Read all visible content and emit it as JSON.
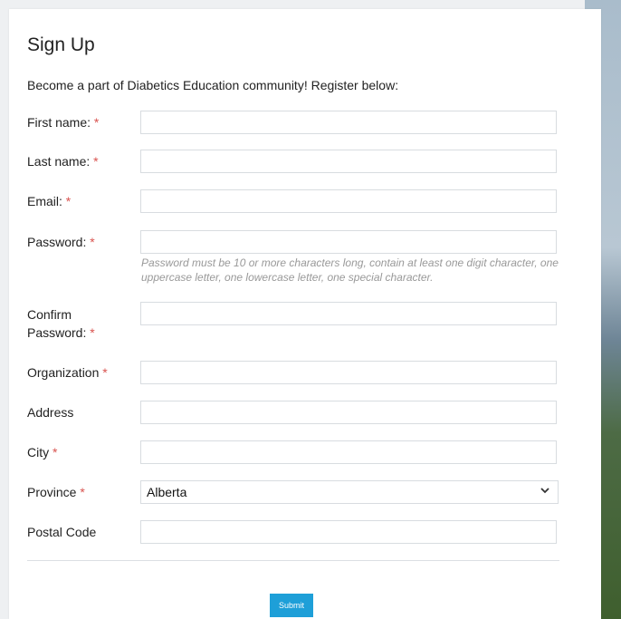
{
  "form": {
    "title": "Sign Up",
    "intro": "Become a part of Diabetics Education community! Register below:",
    "required_mark": "*",
    "fields": {
      "first_name": {
        "label": "First name:",
        "value": ""
      },
      "last_name": {
        "label": "Last name:",
        "value": ""
      },
      "email": {
        "label": "Email:",
        "value": ""
      },
      "password": {
        "label": "Password:",
        "value": "",
        "help": "Password must be 10 or more characters long, contain at least one digit character, one uppercase letter, one lowercase letter, one special character."
      },
      "confirm_password": {
        "label_line1": "Confirm",
        "label_line2": "Password:",
        "value": ""
      },
      "organization": {
        "label": "Organization",
        "value": ""
      },
      "address": {
        "label": "Address",
        "value": ""
      },
      "city": {
        "label": "City",
        "value": ""
      },
      "province": {
        "label": "Province",
        "selected": "Alberta"
      },
      "postal_code": {
        "label": "Postal Code",
        "value": ""
      }
    },
    "submit_label": "Submit"
  },
  "icons": {
    "province_select": "chevron-down-icon"
  },
  "colors": {
    "accent": "#1e9fd8",
    "required": "#d9534f"
  }
}
